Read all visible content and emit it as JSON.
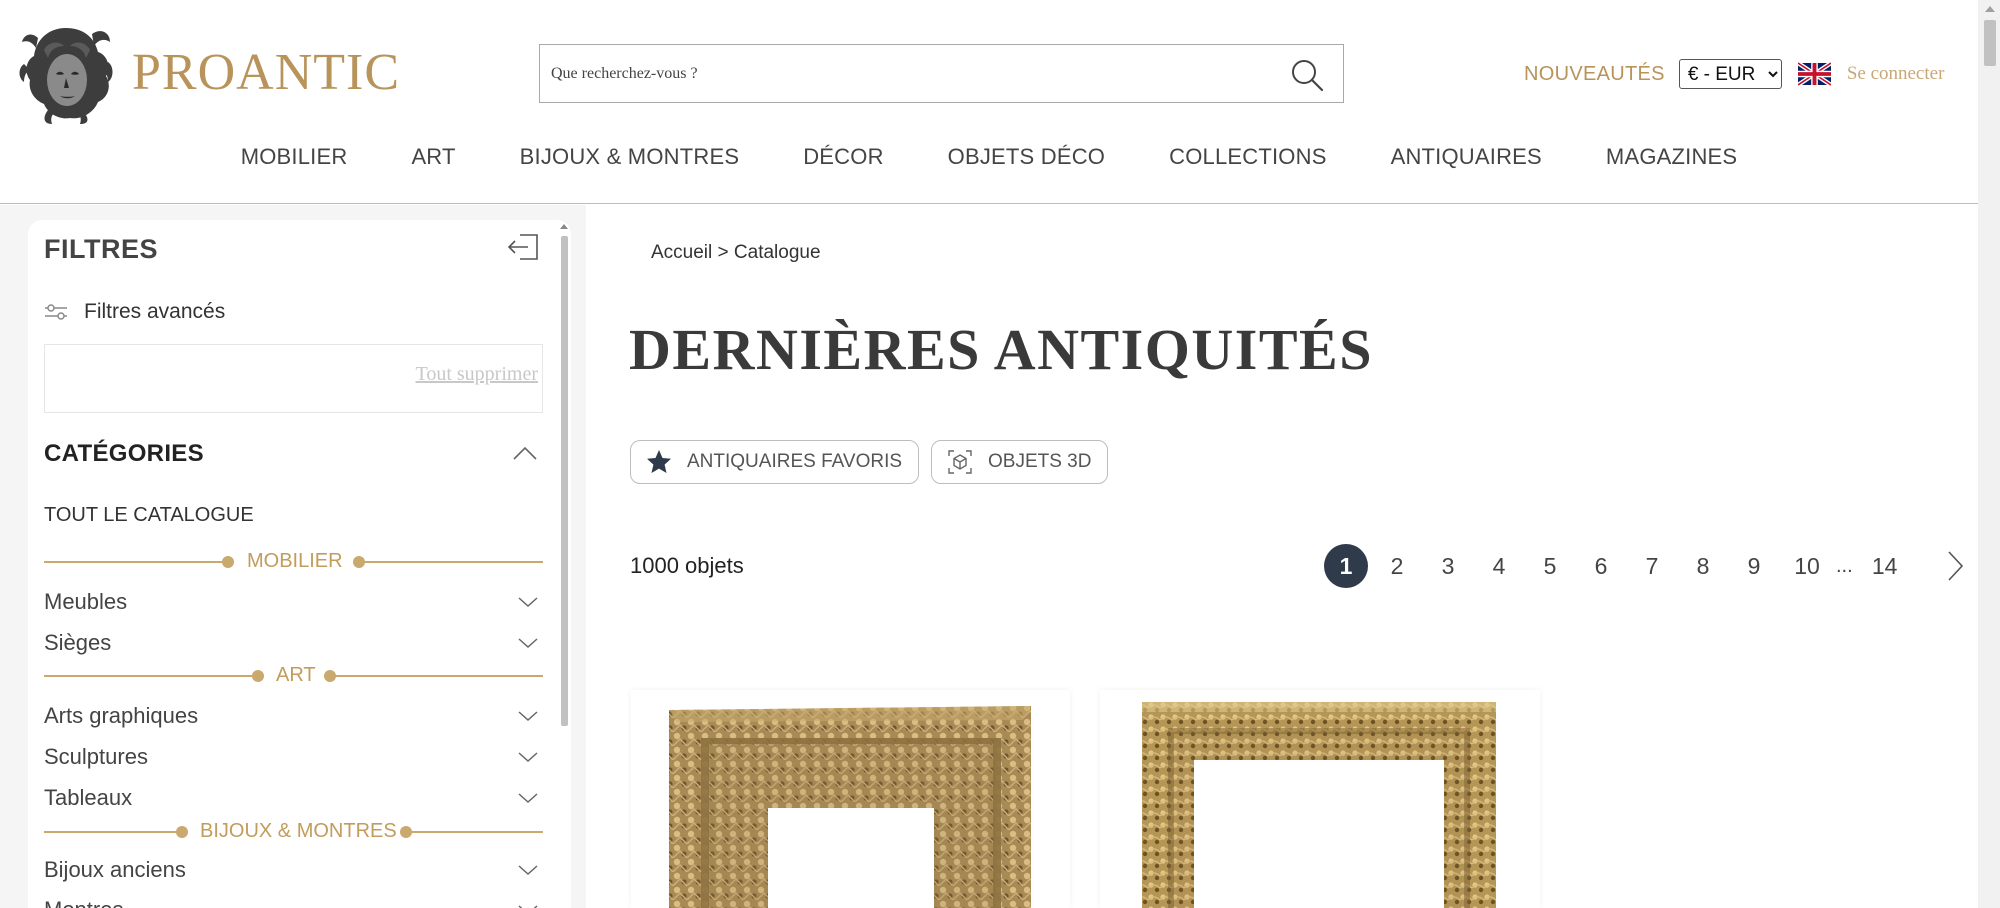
{
  "brand": {
    "name": "PROANTIC",
    "accent": "#b8935a"
  },
  "search": {
    "placeholder": "Que recherchez-vous ?"
  },
  "header": {
    "news_label": "NOUVEAUTÉS",
    "currency": {
      "selected": "€ - EUR",
      "options": [
        "€ - EUR"
      ]
    },
    "login_label": "Se connecter",
    "flag_icon": "uk-flag-icon"
  },
  "nav": {
    "items": [
      "MOBILIER",
      "ART",
      "BIJOUX & MONTRES",
      "DÉCOR",
      "OBJETS DÉCO",
      "COLLECTIONS",
      "ANTIQUAIRES",
      "MAGAZINES"
    ]
  },
  "filters": {
    "title": "FILTRES",
    "advanced_label": "Filtres avancés",
    "clear_all_label": "Tout supprimer",
    "categories_title": "CATÉGORIES",
    "all_catalogue": "TOUT LE CATALOGUE",
    "groups": [
      {
        "label": "MOBILIER",
        "items": [
          "Meubles",
          "Sièges"
        ]
      },
      {
        "label": "ART",
        "items": [
          "Arts graphiques",
          "Sculptures",
          "Tableaux"
        ]
      },
      {
        "label": "BIJOUX & MONTRES",
        "items": [
          "Bijoux anciens",
          "Montres"
        ]
      }
    ]
  },
  "main": {
    "breadcrumb": {
      "home": "Accueil",
      "separator": ">",
      "current": "Catalogue"
    },
    "title": "DERNIÈRES ANTIQUITÉS",
    "chips": {
      "favorites": "ANTIQUAIRES FAVORIS",
      "objects3d": "OBJETS 3D"
    },
    "count": "1000 objets",
    "pagination": {
      "pages": [
        "1",
        "2",
        "3",
        "4",
        "5",
        "6",
        "7",
        "8",
        "9",
        "10"
      ],
      "ellipsis": "...",
      "last": "14",
      "current": "1"
    }
  },
  "colors": {
    "gold": "#c9a96e",
    "pager_active": "#2f3a4a"
  }
}
